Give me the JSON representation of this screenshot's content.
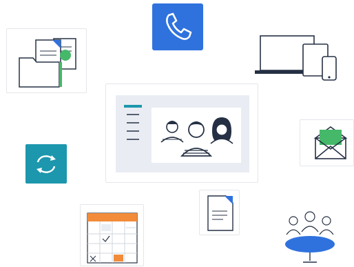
{
  "illustration": {
    "tiles": {
      "files": {
        "icon": "file-sharing-icon"
      },
      "phone": {
        "icon": "phone-icon"
      },
      "devices": {
        "icon": "devices-icon"
      },
      "video_call": {
        "icon": "video-conference-icon"
      },
      "mail": {
        "icon": "envelope-icon"
      },
      "sync": {
        "icon": "sync-icon"
      },
      "document": {
        "icon": "document-icon"
      },
      "calendar": {
        "icon": "calendar-icon"
      },
      "meeting": {
        "icon": "meeting-table-icon"
      }
    },
    "colors": {
      "blue": "#2f72de",
      "teal": "#1c97ad",
      "green": "#45b86a",
      "orange": "#f28c3a",
      "navy": "#253044",
      "border": "#e3e6ea",
      "panel": "#e9edf3"
    }
  }
}
